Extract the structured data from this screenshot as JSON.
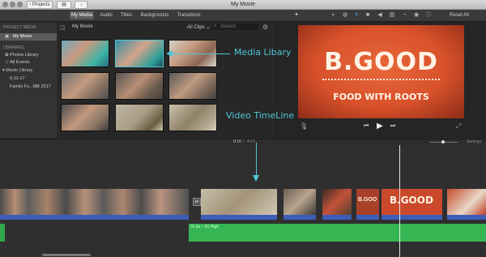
{
  "window": {
    "title": "My Movie",
    "projects_button": "Projects"
  },
  "toolbar": {
    "tabs": [
      "My Media",
      "Audio",
      "Titles",
      "Backgrounds",
      "Transitions"
    ],
    "reset_all": "Reset All"
  },
  "sidebar": {
    "project_media_header": "PROJECT MEDIA",
    "project_item": "My Movie",
    "libraries_header": "LIBRARIES",
    "items": [
      "Photos Library",
      "All Events",
      "Movie Library",
      "6-11-17",
      "Family Fu...MB 2017"
    ]
  },
  "browser": {
    "title": "My Movie",
    "filter": "All Clips",
    "search_placeholder": "Search"
  },
  "viewer": {
    "sign_line1": "B.GOOD",
    "sign_line2": "FOOD WITH ROOTS"
  },
  "timeline": {
    "timecode_current": "0:16",
    "timecode_total": "4:10",
    "settings": "Settings",
    "audio_label": "31.6s – 01 High",
    "clip_sign_1": "B.GOO",
    "clip_sign_2": "B.GOOD"
  },
  "annotations": {
    "media_library": "Media Libary",
    "video_timeline": "Video TimeLine"
  },
  "colors": {
    "annotation": "#4fc6d6",
    "audio_track": "#2fa84a",
    "clip_audio": "#3d5db8",
    "sign_orange": "#d8512a"
  }
}
